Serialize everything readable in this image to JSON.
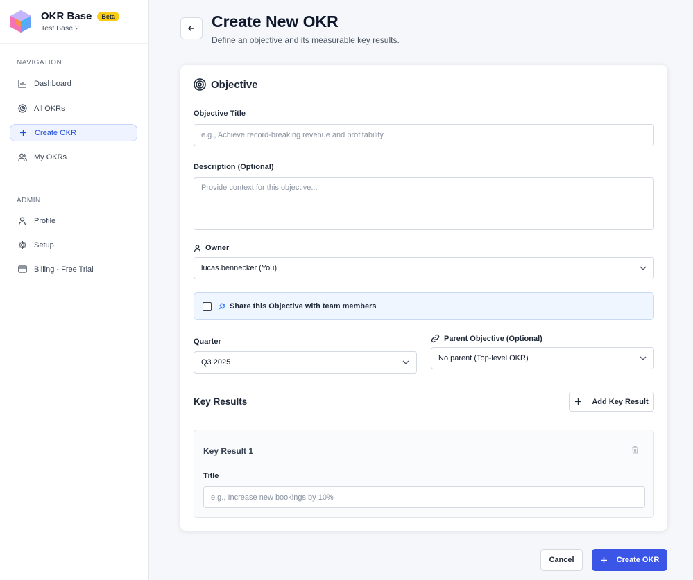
{
  "brand": {
    "title": "OKR Base",
    "badge": "Beta",
    "subtitle": "Test Base 2"
  },
  "nav": {
    "section_label": "NAVIGATION",
    "items": [
      {
        "label": "Dashboard",
        "icon": "bar-chart-icon"
      },
      {
        "label": "All OKRs",
        "icon": "target-icon"
      },
      {
        "label": "Create OKR",
        "icon": "plus-icon",
        "active": true
      },
      {
        "label": "My OKRs",
        "icon": "users-icon"
      }
    ]
  },
  "admin": {
    "section_label": "ADMIN",
    "items": [
      {
        "label": "Profile",
        "icon": "user-icon"
      },
      {
        "label": "Setup",
        "icon": "gear-icon"
      },
      {
        "label": "Billing - Free Trial",
        "icon": "credit-card-icon"
      }
    ]
  },
  "page": {
    "title": "Create New OKR",
    "subtitle": "Define an objective and its measurable key results."
  },
  "objective": {
    "heading": "Objective",
    "title_label": "Objective Title",
    "title_placeholder": "e.g., Achieve record-breaking revenue and profitability",
    "description_label": "Description (Optional)",
    "description_placeholder": "Provide context for this objective...",
    "owner_label": "Owner",
    "owner_value": "lucas.bennecker (You)",
    "share_label": "Share this Objective with team members",
    "quarter_label": "Quarter",
    "quarter_value": "Q3 2025",
    "parent_label": "Parent Objective (Optional)",
    "parent_value": "No parent (Top-level OKR)"
  },
  "key_results": {
    "heading": "Key Results",
    "add_label": "Add Key Result",
    "items": [
      {
        "heading": "Key Result 1",
        "title_label": "Title",
        "title_placeholder": "e.g., Increase new bookings by 10%"
      }
    ]
  },
  "actions": {
    "cancel_label": "Cancel",
    "create_label": "Create OKR"
  },
  "colors": {
    "accent": "#3b55e6",
    "badge": "#facc15",
    "active_nav": "#1d4ed8"
  }
}
